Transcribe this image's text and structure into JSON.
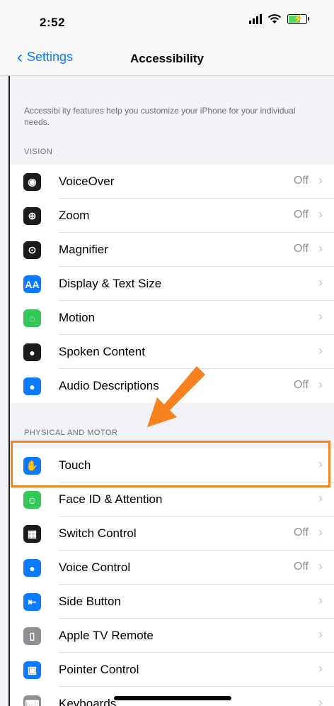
{
  "status": {
    "time": "2:52"
  },
  "nav": {
    "back_label": "Settings",
    "title": "Accessibility"
  },
  "description": "Accessibi ity features help you customize your iPhone for your individual needs.",
  "sections": {
    "vision_header": "VISION",
    "physical_header": "PHYSICAL AND MOTOR"
  },
  "vision_items": [
    {
      "label": "VoiceOver",
      "value": "Off",
      "icon": "voiceover-icon",
      "color": "#1c1c1e"
    },
    {
      "label": "Zoom",
      "value": "Off",
      "icon": "zoom-icon",
      "color": "#1c1c1e"
    },
    {
      "label": "Magnifier",
      "value": "Off",
      "icon": "magnifier-icon",
      "color": "#1c1c1e"
    },
    {
      "label": "Display & Text Size",
      "value": "",
      "icon": "display-text-icon",
      "color": "#0a7aff",
      "glyph": "AA"
    },
    {
      "label": "Motion",
      "value": "",
      "icon": "motion-icon",
      "color": "#34c759"
    },
    {
      "label": "Spoken Content",
      "value": "",
      "icon": "speech-bubble-icon",
      "color": "#1c1c1e"
    },
    {
      "label": "Audio Descriptions",
      "value": "Off",
      "icon": "audio-description-icon",
      "color": "#0a7aff"
    }
  ],
  "physical_items": [
    {
      "label": "Touch",
      "value": "",
      "icon": "hand-icon",
      "color": "#0a7aff"
    },
    {
      "label": "Face ID & Attention",
      "value": "",
      "icon": "face-id-icon",
      "color": "#34c759"
    },
    {
      "label": "Switch Control",
      "value": "Off",
      "icon": "switch-control-icon",
      "color": "#1c1c1e"
    },
    {
      "label": "Voice Control",
      "value": "Off",
      "icon": "voice-control-icon",
      "color": "#0a7aff"
    },
    {
      "label": "Side Button",
      "value": "",
      "icon": "side-button-icon",
      "color": "#0a7aff"
    },
    {
      "label": "Apple TV Remote",
      "value": "",
      "icon": "remote-icon",
      "color": "#8e8e93"
    },
    {
      "label": "Pointer Control",
      "value": "",
      "icon": "pointer-icon",
      "color": "#0a7aff"
    },
    {
      "label": "Keyboards",
      "value": "",
      "icon": "keyboard-icon",
      "color": "#8e8e93"
    }
  ],
  "annotation": {
    "highlight_color": "#f5821f"
  }
}
